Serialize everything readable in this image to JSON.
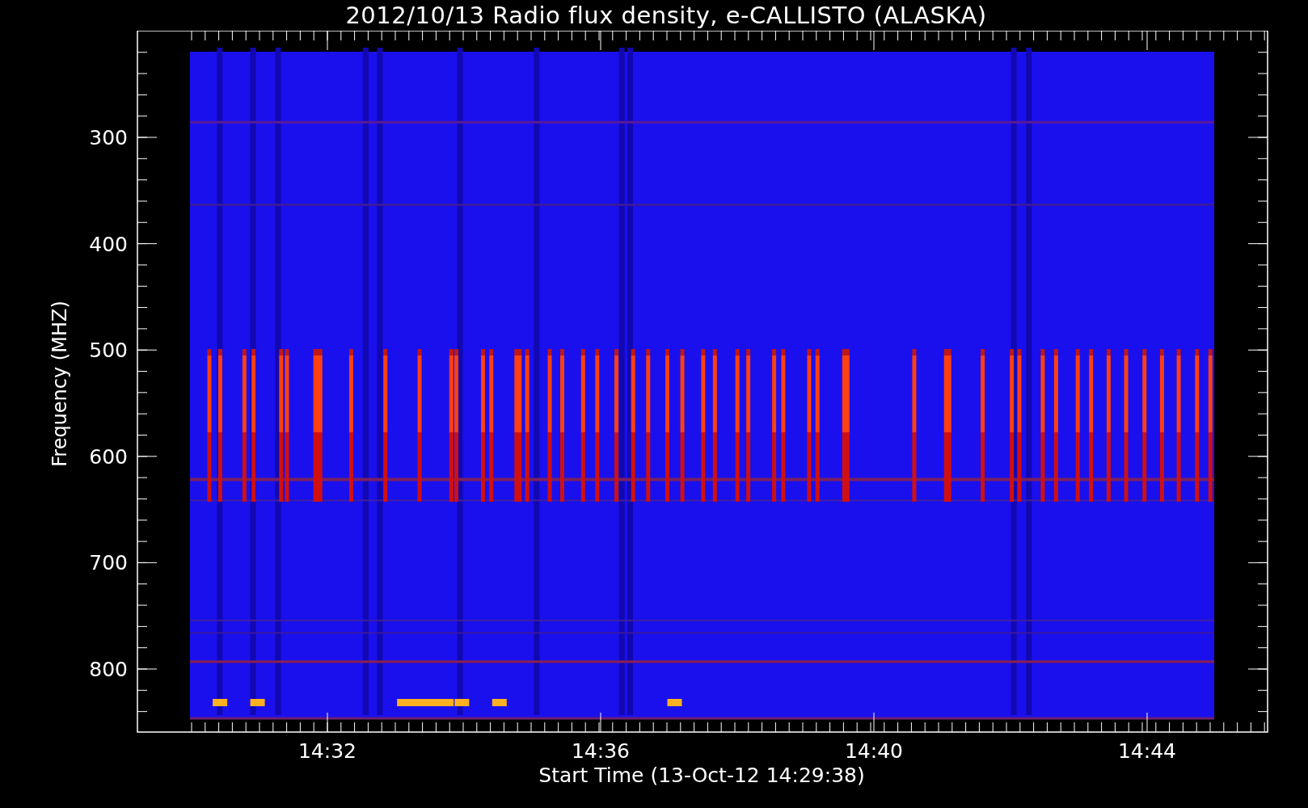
{
  "title": "2012/10/13  Radio flux density, e-CALLISTO (ALASKA)",
  "y_axis": {
    "label": "Frequency (MHZ)",
    "ticks": [
      "300",
      "400",
      "500",
      "600",
      "700",
      "800"
    ]
  },
  "x_axis": {
    "label": "Start Time (13-Oct-12 14:29:38)",
    "ticks": [
      "14:32",
      "14:36",
      "14:40",
      "14:44"
    ]
  }
}
